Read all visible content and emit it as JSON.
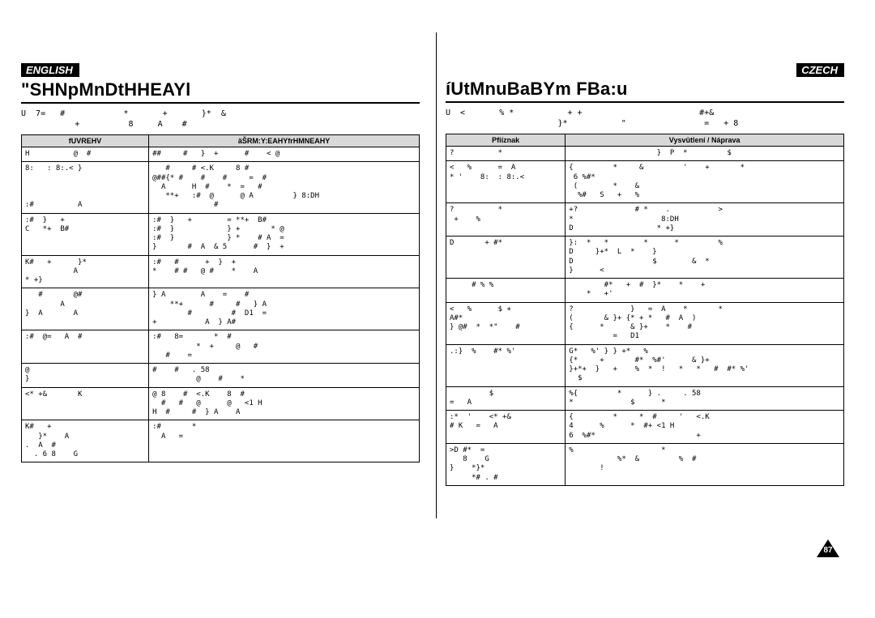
{
  "left": {
    "lang": "ENGLISH",
    "title": "\"SHNpMnDtHHEAYl",
    "intro": "U  7=   #            *       +       }*  &\n           +          8     A    #",
    "th1": "fUVREHV",
    "th2": "äŠRM:Y:EAHYfrHMNEAHY",
    "rows": [
      [
        "H          @  # ",
        "##     #   }  +      #    < @"
      ],
      [
        "8:   : 8:.< }\n\n\n\n:#          A",
        "   #     # <.K     8 #\n@##{* #    #    #     =  #\n  A      H  #    *  =   #\n   **+   :#  @      @ A         } 8:DH\n              #"
      ],
      [
        ":#  }   +\nC   *+  B#",
        ":#  }   +        = **+  B#\n:#  }            } +       * @\n:#  }            } *    # A  =\n}       #  A  & 5      #  }  +"
      ],
      [
        "K#   +      }*\n           A\n* +}",
        ":#   #      +  }  +\n*    # #   @ #    *    A"
      ],
      [
        "   #       @#\n        A\n}  A       A",
        "} A        A    =    #\n    **+      #     #   } A\n        #         #  D1  =\n+           A  } A#"
      ],
      [
        ":#  @=   A  #",
        ":#   8=       *  #\n          *  +     @   #\n   #    ="
      ],
      [
        "@\n}",
        "#    #   . 58\n          @    #    *"
      ],
      [
        "<* +&       K",
        "@ 8    #  <.K    8  #\n  #   #   @      @   <1 H\nH  #     #  } A    A"
      ],
      [
        "K#   +\n   }*    A\n.  A  #\n  . 6 8    G",
        ":#       *\n  A   ="
      ]
    ]
  },
  "right": {
    "lang": "CZECH",
    "title": "íUtMnuBaBYm FBa:u",
    "intro": "U  <       % *           + +                        #+&\n                       }*           \"                =   + 8",
    "th1": "Pfiíznak",
    "th2": "Vysvûtlení / Náprava",
    "rows": [
      [
        "?          *",
        "                    }  P  *         $"
      ],
      [
        "<   %      =  A\n* '    8:  : 8:.<",
        "{         *     &         '    +       *\n 6 %#*\n (        *    &\n  %#   S   +   %"
      ],
      [
        "?          *\n +    %",
        "+?             # *    .           >\n*                    8:DH\nD                   * +}"
      ],
      [
        "D       + #*",
        "}:  *   *        *      *         %\nD     }+*  L  *    }\nD                  $        &  *\n}      <"
      ],
      [
        "     # % %",
        "        #*   +  #  }*    *    +\n    *   +'"
      ],
      [
        "<   %      $ +\nA#*\n} @#  *  *\"    #",
        "?             }   =  A    *       *\n(       & }+ {* + *   #  A  )\n{      *      & }+    *    #\n          =   D1"
      ],
      [
        ".:}  %    #* %'",
        "G*   %' } } +*   %\n{*     +       #*  %#'      & }+\n}+*+  }   +    %  *  !   *   *   #  #* %'\n  $"
      ],
      [
        "         $\n=   A",
        "%{         *      } .     . 58\n*             $      *"
      ],
      [
        ":*  '    <* +&\n# K   =   A",
        "{         *     *  #     '   <.K\n4      %      *  #+ <1 H\n6  %#*                       +"
      ],
      [
        ">D #*  =\n   8    G\n}    *}*\n     *# . #",
        "%                    *\n           %*  &         %  #\n       !"
      ]
    ]
  },
  "page_number": "87"
}
